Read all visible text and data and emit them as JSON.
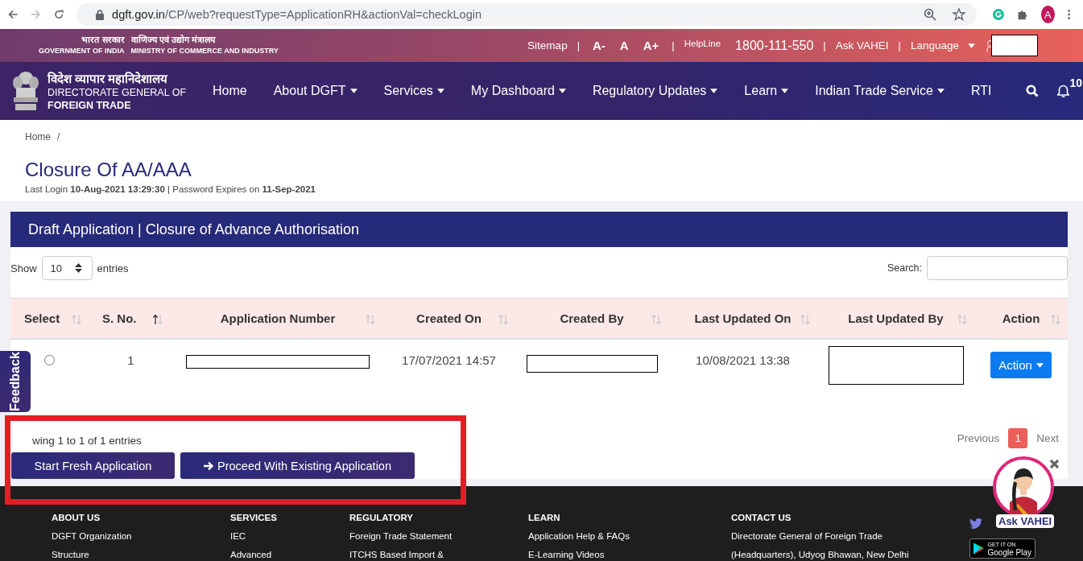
{
  "browser": {
    "url_host": "dgft.gov.in",
    "url_path": "/CP/web?requestType=ApplicationRH&actionVal=checkLogin",
    "avatar": "A"
  },
  "top_bar": {
    "gov_hindi": "भारत सरकार",
    "gov_english": "GOVERNMENT OF INDIA",
    "ministry_hindi": "वाणिज्य एवं उद्योग मंत्रालय",
    "ministry_english": "MINISTRY OF COMMERCE AND INDUSTRY",
    "items": [
      {
        "kind": "link",
        "label": "Sitemap"
      },
      {
        "kind": "separator",
        "label": "|"
      },
      {
        "kind": "font",
        "label": "A-"
      },
      {
        "kind": "font",
        "label": "A"
      },
      {
        "kind": "font",
        "label": "A+"
      },
      {
        "kind": "separator",
        "label": "|"
      },
      {
        "kind": "helpline",
        "label": "HelpLine"
      },
      {
        "kind": "phone",
        "label": "1800-111-550"
      },
      {
        "kind": "separator",
        "label": "|"
      },
      {
        "kind": "link",
        "label": "Ask VAHEI"
      },
      {
        "kind": "separator",
        "label": "|"
      },
      {
        "kind": "dropdown",
        "label": "Language"
      },
      {
        "kind": "user"
      }
    ]
  },
  "nav": {
    "logo_hindi": "विदेश व्यापार महानिदेशालय",
    "logo_line1": "DIRECTORATE GENERAL OF",
    "logo_line2": "FOREIGN TRADE",
    "items": [
      {
        "label": "Home",
        "dropdown": false
      },
      {
        "label": "About DGFT",
        "dropdown": true
      },
      {
        "label": "Services",
        "dropdown": true
      },
      {
        "label": "My Dashboard",
        "dropdown": true
      },
      {
        "label": "Regulatory Updates",
        "dropdown": true
      },
      {
        "label": "Learn",
        "dropdown": true
      },
      {
        "label": "Indian Trade Service",
        "dropdown": true
      },
      {
        "label": "RTI",
        "dropdown": false
      }
    ],
    "notifications": "10"
  },
  "breadcrumb": {
    "items": [
      "Home"
    ],
    "separator": "/"
  },
  "title": "Closure Of AA/AAA",
  "login_info": "Last Login **10-Aug-2021 13:29:30** | Password Expires on **11-Sep-2021**",
  "card": {
    "title": "Draft Application | Closure of Advance Authorisation",
    "length": {
      "before": "Show",
      "value": "10",
      "after": "entries"
    },
    "search": {
      "label": "Search:"
    },
    "columns": [
      {
        "label": "Select",
        "sorted": false
      },
      {
        "label": "S. No.",
        "sorted": true
      },
      {
        "label": "Application Number",
        "sorted": false
      },
      {
        "label": "Created On",
        "sorted": false
      },
      {
        "label": "Created By",
        "sorted": false
      },
      {
        "label": "Last Updated On",
        "sorted": false
      },
      {
        "label": "Last Updated By",
        "sorted": false
      },
      {
        "label": "Action",
        "sorted": false
      }
    ],
    "rows": [
      {
        "cells": [
          {
            "kind": "radio",
            "selected": false
          },
          {
            "kind": "text",
            "text": "1"
          },
          {
            "kind": "redacted"
          },
          {
            "kind": "text",
            "text": "17/07/2021 14:57"
          },
          {
            "kind": "redacted"
          },
          {
            "kind": "text",
            "text": "10/08/2021 13:38"
          },
          {
            "kind": "redacted_tall"
          },
          {
            "kind": "button",
            "label": "Action"
          }
        ]
      }
    ],
    "info": "wing 1 to 1 of 1 entries",
    "pagination": {
      "previous": "Previous",
      "pages": [
        {
          "label": "1",
          "selected": true
        }
      ],
      "next": "Next"
    },
    "buttons": [
      {
        "kind": "plain",
        "label": "Start Fresh Application"
      },
      {
        "kind": "proceed",
        "label": "Proceed With Existing Application"
      }
    ]
  },
  "feedback": "Feedback",
  "chat": {
    "label": "Ask VAHEI"
  },
  "footer": {
    "columns": [
      {
        "heading": "ABOUT US",
        "links": [
          "DGFT Organization",
          "Structure"
        ]
      },
      {
        "heading": "SERVICES",
        "links": [
          "IEC",
          "Advanced"
        ]
      },
      {
        "heading": "REGULATORY",
        "links": [
          "Foreign Trade Statement",
          "ITCHS Based Import &"
        ]
      },
      {
        "heading": "LEARN",
        "links": [
          "Application Help & FAQs",
          "E-Learning Videos"
        ]
      },
      {
        "heading": "CONTACT US",
        "links": [
          "Directorate General of Foreign Trade",
          "(Headquarters), Udyog Bhawan, New Delhi"
        ]
      }
    ],
    "store_badge": {
      "small": "GET IT ON",
      "large": "Google Play"
    }
  }
}
